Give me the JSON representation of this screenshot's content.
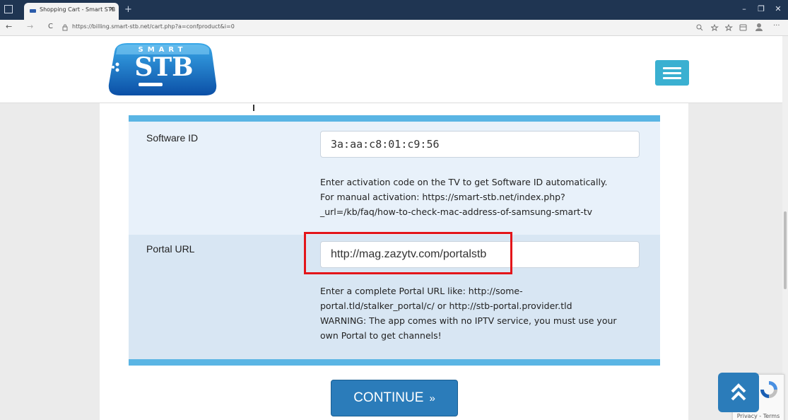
{
  "browser": {
    "tab_title": "Shopping Cart - Smart STB",
    "tab_close": "×",
    "new_tab": "+",
    "url": "https://billing.smart-stb.net/cart.php?a=confproduct&i=0",
    "window_minimize": "–",
    "window_restore": "❐",
    "window_close": "✕",
    "nav_back": "←",
    "nav_forward": "→",
    "nav_reload": "C",
    "more_menu": "···"
  },
  "logo": {
    "top_text": "SMART",
    "main_text": "STB"
  },
  "form": {
    "software_id": {
      "label": "Software ID",
      "value": "3a:aa:c8:01:c9:56",
      "help_lines": [
        "Enter activation code on the TV to get Software ID automatically.",
        "For manual activation: https://smart-stb.net/index.php?",
        "_url=/kb/faq/how-to-check-mac-address-of-samsung-smart-tv"
      ]
    },
    "portal_url": {
      "label": "Portal URL",
      "value": "http://mag.zazytv.com/portalstb",
      "help_lines": [
        "Enter a complete Portal URL like: http://some-",
        "portal.tld/stalker_portal/c/ or http://stb-portal.provider.tld",
        "WARNING: The app comes with no IPTV service, you must use your",
        "own Portal to get channels!"
      ]
    }
  },
  "continue_button": {
    "label": "CONTINUE",
    "arrow": "»"
  },
  "back_to_top": {
    "icon": "double-chevron-up"
  },
  "recaptcha": {
    "text": "Privacy - Terms"
  },
  "colors": {
    "titlebar": "#1f3552",
    "accent_blue": "#2b7cba",
    "menu_button": "#3ab0d1",
    "section_bar": "#5ab5e4",
    "highlight_box": "#e3151a"
  }
}
